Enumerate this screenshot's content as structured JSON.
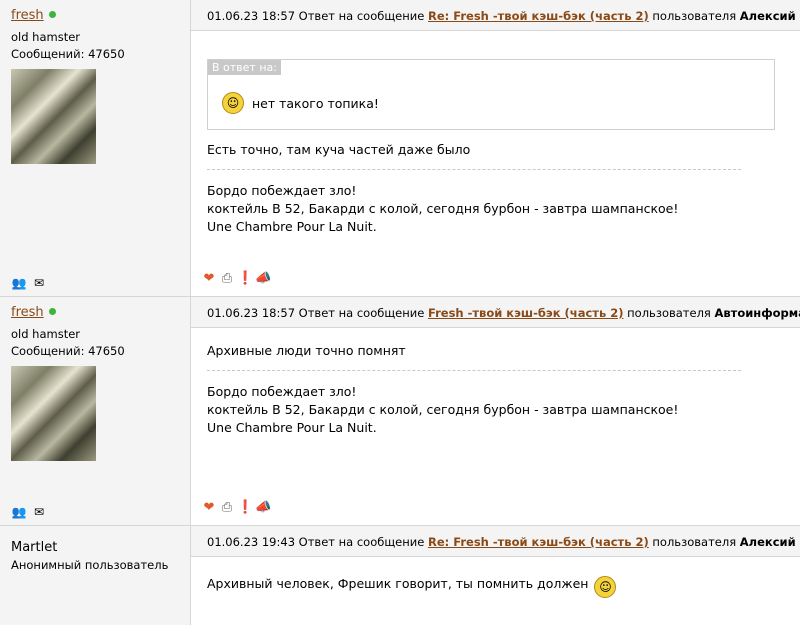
{
  "posts": [
    {
      "username": "fresh",
      "rank": "old hamster",
      "messages": "Сообщений: 47650",
      "date": "01.06.23 18:57",
      "reply_prefix": "Ответ на сообщение",
      "thread_link": "Re: Fresh -твой кэш-бэк (часть 2)",
      "user_prefix": "пользователя",
      "reply_to_user": "Алексий",
      "quote_label": "В ответ на:",
      "quote_text": "нет такого топика!",
      "text": "Есть точно, там куча частей даже было",
      "signature": [
        "Бордо побеждает зло!",
        "коктейль В 52, Бакарди с колой, сегодня бурбон - завтра шампанское!",
        "Une Chambre Pour La Nuit."
      ]
    },
    {
      "username": "fresh",
      "rank": "old hamster",
      "messages": "Сообщений: 47650",
      "date": "01.06.23 18:57",
      "reply_prefix": "Ответ на сообщение",
      "thread_link": "Fresh -твой кэш-бэк (часть 2)",
      "user_prefix": "пользователя",
      "reply_to_user": "Автоинформатор",
      "text": "Архивные люди точно помнят",
      "signature": [
        "Бордо побеждает зло!",
        "коктейль В 52, Бакарди с колой, сегодня бурбон - завтра шампанское!",
        "Une Chambre Pour La Nuit."
      ]
    },
    {
      "username": "Martlet",
      "rank": "Анонимный пользователь",
      "date": "01.06.23 19:43",
      "reply_prefix": "Ответ на сообщение",
      "thread_link": "Re: Fresh -твой кэш-бэк (часть 2)",
      "user_prefix": "пользователя",
      "reply_to_user": "Алексий",
      "text": "Архивный человек, Фрешик говорит, ты помнить должен"
    }
  ],
  "icons": {
    "add_user": "add-contact-icon",
    "message": "envelope-icon",
    "like": "heart-icon",
    "print": "printer-icon",
    "report": "alert-icon",
    "megaphone": "megaphone-icon",
    "online": "online-dot-icon"
  },
  "colors": {
    "link": "#8a4a18",
    "online": "#3bb53b",
    "header_bg": "#f4f4f4"
  }
}
